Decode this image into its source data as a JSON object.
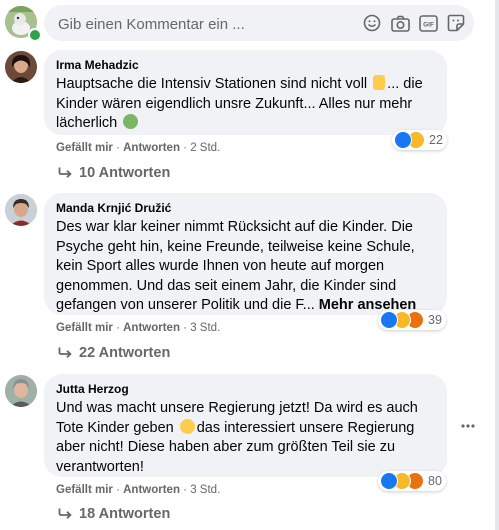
{
  "composer": {
    "placeholder": "Gib einen Kommentar ein ...",
    "icons": [
      "smiley-icon",
      "camera-icon",
      "gif-icon",
      "sticker-icon"
    ]
  },
  "comments": [
    {
      "author": "Irma Mehadzic",
      "lines": [
        "Hauptsache die Intensiv Stationen sind nicht voll",
        "Kinder wären eigendlich unsre Zukunft... Alles nur mehr",
        "lächerlich"
      ],
      "line1_suffix": "... die",
      "inline_emojis": [
        "thumbs-up-emoji",
        "nauseated-face-emoji"
      ],
      "like": "Gefällt mir",
      "reply": "Antworten",
      "time": "2 Std.",
      "reactions": [
        "like",
        "haha"
      ],
      "reaction_count": "22",
      "replies": "10 Antworten"
    },
    {
      "author": "Manda Krnjić Družić",
      "lines": [
        "Des war klar keiner nimmt Rücksicht auf die Kinder. Die",
        "Psyche geht hin, keine Freunde, teilweise keine Schule,",
        "kein Sport alles wurde Ihnen von heute auf morgen",
        "genommen. Und das seit einem Jahr, die Kinder sind",
        "gefangen von unserer Politik und die F..."
      ],
      "see_more": "Mehr ansehen",
      "like": "Gefällt mir",
      "reply": "Antworten",
      "time": "3 Std.",
      "reactions": [
        "like",
        "sad",
        "angry"
      ],
      "reaction_count": "39",
      "replies": "22 Antworten"
    },
    {
      "author": "Jutta Herzog",
      "lines": [
        "Und was macht unsere Regierung jetzt! Da wird es auch",
        "Tote Kinder geben",
        "aber nicht! Diese haben aber zum größten Teil sie zu",
        "verantworten!"
      ],
      "line2_suffix": "das interessiert unsere Regierung",
      "inline_emojis": [
        "sad-face-emoji"
      ],
      "like": "Gefällt mir",
      "reply": "Antworten",
      "time": "3 Std.",
      "reactions": [
        "like",
        "sad",
        "angry"
      ],
      "reaction_count": "80",
      "replies": "18 Antworten"
    }
  ],
  "colors": {
    "bubble": "#f0f2f5",
    "meta": "#65676b",
    "like_blue": "#1877f2",
    "online_green": "#31a24c"
  }
}
